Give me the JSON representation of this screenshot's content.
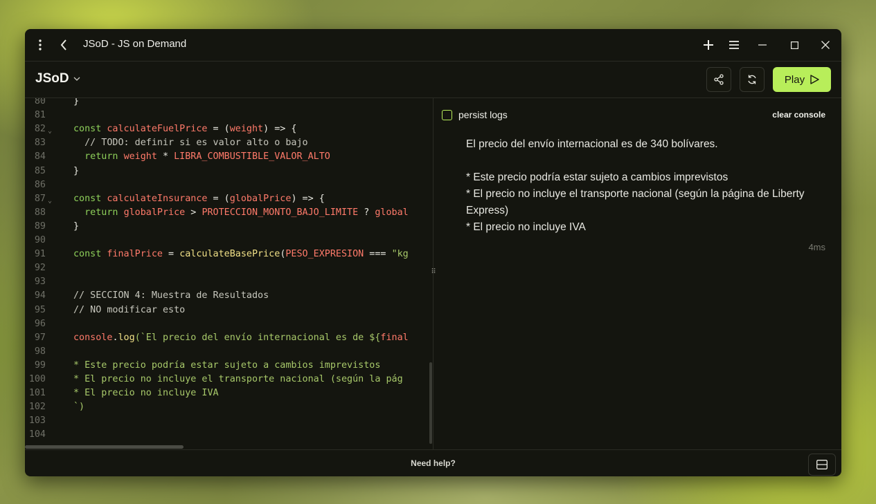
{
  "window": {
    "title": "JSoD - JS on Demand"
  },
  "toolbar": {
    "brand": "JSoD",
    "play_label": "Play"
  },
  "editor": {
    "lines": [
      {
        "n": "80",
        "fold": false,
        "tokens": [
          {
            "t": "}",
            "c": "p"
          }
        ]
      },
      {
        "n": "81",
        "fold": false,
        "tokens": []
      },
      {
        "n": "82",
        "fold": true,
        "tokens": [
          {
            "t": "const ",
            "c": "kw"
          },
          {
            "t": "calculateFuelPrice",
            "c": "var"
          },
          {
            "t": " = (",
            "c": "p"
          },
          {
            "t": "weight",
            "c": "var"
          },
          {
            "t": ") => {",
            "c": "p"
          }
        ]
      },
      {
        "n": "83",
        "fold": false,
        "tokens": [
          {
            "t": "  // TODO: definir si es valor alto o bajo",
            "c": "cm"
          }
        ]
      },
      {
        "n": "84",
        "fold": false,
        "tokens": [
          {
            "t": "  ",
            "c": "p"
          },
          {
            "t": "return ",
            "c": "kw"
          },
          {
            "t": "weight",
            "c": "var"
          },
          {
            "t": " * ",
            "c": "p"
          },
          {
            "t": "LIBRA_COMBUSTIBLE_VALOR_ALTO",
            "c": "var"
          }
        ]
      },
      {
        "n": "85",
        "fold": false,
        "tokens": [
          {
            "t": "}",
            "c": "p"
          }
        ]
      },
      {
        "n": "86",
        "fold": false,
        "tokens": []
      },
      {
        "n": "87",
        "fold": true,
        "tokens": [
          {
            "t": "const ",
            "c": "kw"
          },
          {
            "t": "calculateInsurance",
            "c": "var"
          },
          {
            "t": " = (",
            "c": "p"
          },
          {
            "t": "globalPrice",
            "c": "var"
          },
          {
            "t": ") => {",
            "c": "p"
          }
        ]
      },
      {
        "n": "88",
        "fold": false,
        "tokens": [
          {
            "t": "  ",
            "c": "p"
          },
          {
            "t": "return ",
            "c": "kw"
          },
          {
            "t": "globalPrice",
            "c": "var"
          },
          {
            "t": " > ",
            "c": "p"
          },
          {
            "t": "PROTECCION_MONTO_BAJO_LIMITE",
            "c": "var"
          },
          {
            "t": " ? ",
            "c": "p"
          },
          {
            "t": "global",
            "c": "var"
          }
        ]
      },
      {
        "n": "89",
        "fold": false,
        "tokens": [
          {
            "t": "}",
            "c": "p"
          }
        ]
      },
      {
        "n": "90",
        "fold": false,
        "tokens": []
      },
      {
        "n": "91",
        "fold": false,
        "tokens": [
          {
            "t": "const ",
            "c": "kw"
          },
          {
            "t": "finalPrice",
            "c": "var"
          },
          {
            "t": " = ",
            "c": "p"
          },
          {
            "t": "calculateBasePrice",
            "c": "fn"
          },
          {
            "t": "(",
            "c": "p"
          },
          {
            "t": "PESO_EXPRESION",
            "c": "var"
          },
          {
            "t": " === ",
            "c": "p"
          },
          {
            "t": "\"kg",
            "c": "str"
          }
        ]
      },
      {
        "n": "92",
        "fold": false,
        "tokens": []
      },
      {
        "n": "93",
        "fold": false,
        "tokens": []
      },
      {
        "n": "94",
        "fold": false,
        "tokens": [
          {
            "t": "// SECCION 4: Muestra de Resultados",
            "c": "cm"
          }
        ]
      },
      {
        "n": "95",
        "fold": false,
        "tokens": [
          {
            "t": "// NO modificar esto",
            "c": "cm"
          }
        ]
      },
      {
        "n": "96",
        "fold": false,
        "tokens": []
      },
      {
        "n": "97",
        "fold": false,
        "tokens": [
          {
            "t": "console",
            "c": "var"
          },
          {
            "t": ".",
            "c": "p"
          },
          {
            "t": "log",
            "c": "fn"
          },
          {
            "t": "(`El precio del envío internacional es de ${",
            "c": "str"
          },
          {
            "t": "final",
            "c": "var"
          }
        ]
      },
      {
        "n": "98",
        "fold": false,
        "tokens": []
      },
      {
        "n": "99",
        "fold": false,
        "tokens": [
          {
            "t": "* Este precio podría estar sujeto a cambios imprevistos",
            "c": "str"
          }
        ]
      },
      {
        "n": "100",
        "fold": false,
        "tokens": [
          {
            "t": "* El precio no incluye el transporte nacional (según la pág",
            "c": "str"
          }
        ]
      },
      {
        "n": "101",
        "fold": false,
        "tokens": [
          {
            "t": "* El precio no incluye IVA",
            "c": "str"
          }
        ]
      },
      {
        "n": "102",
        "fold": false,
        "tokens": [
          {
            "t": "`)",
            "c": "str"
          }
        ]
      },
      {
        "n": "103",
        "fold": false,
        "tokens": []
      },
      {
        "n": "104",
        "fold": false,
        "tokens": []
      }
    ]
  },
  "console": {
    "persist_label": "persist logs",
    "clear_label": "clear console",
    "output": "El precio del envío internacional es de 340 bolívares.\n\n* Este precio podría estar sujeto a cambios imprevistos\n* El precio no incluye el transporte nacional (según la página de Liberty Express)\n* El precio no incluye IVA",
    "duration": "4ms"
  },
  "footer": {
    "help_label": "Need help?"
  },
  "colors": {
    "accent": "#b8ee5a",
    "background": "#14150f",
    "keyword": "#8ed05a",
    "identifier": "#ff7a6a",
    "function": "#f0e087",
    "string": "#a8c96a"
  }
}
